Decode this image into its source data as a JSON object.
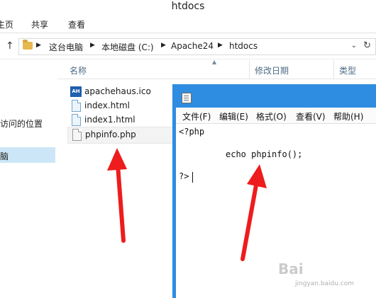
{
  "window": {
    "title": "htdocs"
  },
  "ribbon": {
    "tabs": [
      "主页",
      "共享",
      "查看"
    ]
  },
  "address_bar": {
    "crumbs": [
      "这台电脑",
      "本地磁盘 (C:)",
      "Apache24",
      "htdocs"
    ]
  },
  "nav_pane": {
    "recent_label": "访问的位置",
    "this_pc_label": "脑"
  },
  "file_list": {
    "columns": [
      "名称",
      "修改日期",
      "类型"
    ],
    "files": [
      {
        "name": "apachehaus.ico",
        "icon": "ico-file-icon"
      },
      {
        "name": "index.html",
        "icon": "html-file-icon"
      },
      {
        "name": "index1.html",
        "icon": "html-file-icon"
      },
      {
        "name": "phpinfo.php",
        "icon": "php-file-icon"
      }
    ],
    "ico_badge": "AH"
  },
  "notepad": {
    "menus": [
      "文件(F)",
      "编辑(E)",
      "格式(O)",
      "查看(V)",
      "帮助(H)"
    ],
    "code_lines": [
      "<?php",
      "echo phpinfo();",
      "?>"
    ]
  },
  "annotations": {
    "arrow_color": "#ee1c1c"
  },
  "watermark": {
    "line1": "Bai",
    "line2": "jingyan.baidu.com"
  },
  "colors": {
    "notepad_frame": "#2e8de0",
    "selection": "#cde6f7",
    "folder": "#e7b84f"
  }
}
